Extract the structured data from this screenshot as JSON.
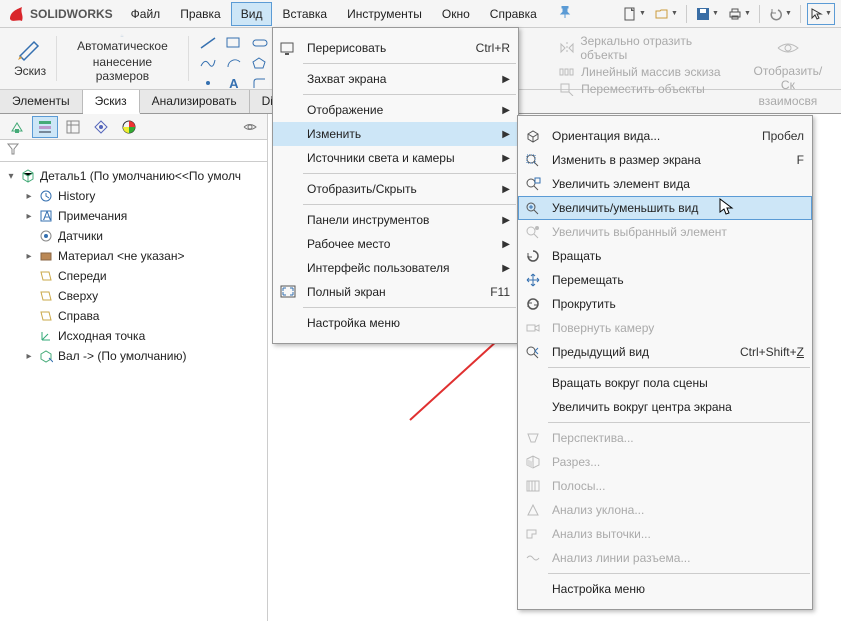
{
  "app": {
    "name": "SOLIDWORKS"
  },
  "menubar": {
    "items": [
      "Файл",
      "Правка",
      "Вид",
      "Вставка",
      "Инструменты",
      "Окно",
      "Справка"
    ],
    "active_index": 2
  },
  "ribbon": {
    "sketch_label": "Эскиз",
    "smartdim_label_1": "Автоматическое",
    "smartdim_label_2": "нанесение размеров",
    "disabled_cmds": {
      "mirror": "Зеркально отразить объекты",
      "linear": "Линейный массив эскиза",
      "move": "Переместить объекты"
    },
    "display_label_1": "Отобразить/Ск",
    "display_label_2": "взаимосвя"
  },
  "tabs": [
    "Элементы",
    "Эскиз",
    "Анализировать",
    "DimXp"
  ],
  "active_tab_index": 1,
  "tree": {
    "root": "Деталь1  (По умолчанию<<По умолч",
    "items": [
      {
        "expander": "▸",
        "label": "History"
      },
      {
        "expander": "▸",
        "label": "Примечания"
      },
      {
        "expander": "",
        "label": "Датчики"
      },
      {
        "expander": "▸",
        "label": "Материал <не указан>"
      },
      {
        "expander": "",
        "label": "Спереди"
      },
      {
        "expander": "",
        "label": "Сверху"
      },
      {
        "expander": "",
        "label": "Справа"
      },
      {
        "expander": "",
        "label": "Исходная точка"
      },
      {
        "expander": "▸",
        "label": "Вал -> (По умолчанию)"
      }
    ]
  },
  "view_menu": {
    "items": [
      {
        "icon": "redraw",
        "label": "Перерисовать",
        "shortcut": "Ctrl+R",
        "arrow": false,
        "sep_after": true
      },
      {
        "icon": "",
        "label": "Захват экрана",
        "shortcut": "",
        "arrow": true,
        "sep_after": true
      },
      {
        "icon": "",
        "label": "Отображение",
        "shortcut": "",
        "arrow": true,
        "sep_after": false
      },
      {
        "icon": "",
        "label": "Изменить",
        "shortcut": "",
        "arrow": true,
        "sep_after": false,
        "highlight": true
      },
      {
        "icon": "",
        "label": "Источники света и камеры",
        "shortcut": "",
        "arrow": true,
        "sep_after": true
      },
      {
        "icon": "",
        "label": "Отобразить/Скрыть",
        "shortcut": "",
        "arrow": true,
        "sep_after": true
      },
      {
        "icon": "",
        "label": "Панели инструментов",
        "shortcut": "",
        "arrow": true,
        "sep_after": false
      },
      {
        "icon": "",
        "label": "Рабочее место",
        "shortcut": "",
        "arrow": true,
        "sep_after": false
      },
      {
        "icon": "",
        "label": "Интерфейс пользователя",
        "shortcut": "",
        "arrow": true,
        "sep_after": false
      },
      {
        "icon": "fullscreen",
        "label": "Полный экран",
        "shortcut": "F11",
        "arrow": false,
        "sep_after": true
      },
      {
        "icon": "",
        "label": "Настройка меню",
        "shortcut": "",
        "arrow": false,
        "sep_after": false
      }
    ]
  },
  "modify_submenu": {
    "items": [
      {
        "icon": "orient",
        "label": "Ориентация вида...",
        "shortcut": "Пробел",
        "disabled": false
      },
      {
        "icon": "zoomfit",
        "label": "Изменить в размер экрана",
        "shortcut": "F",
        "disabled": false
      },
      {
        "icon": "zoomsel",
        "label": "Увеличить элемент вида",
        "shortcut": "",
        "disabled": false
      },
      {
        "icon": "zoom",
        "label": "Увеличить/уменьшить вид",
        "shortcut": "",
        "disabled": false,
        "hovered": true
      },
      {
        "icon": "zoomsel2",
        "label": "Увеличить выбранный элемент",
        "shortcut": "",
        "disabled": true
      },
      {
        "icon": "rotate",
        "label": "Вращать",
        "shortcut": "",
        "disabled": false
      },
      {
        "icon": "pan",
        "label": "Перемещать",
        "shortcut": "",
        "disabled": false
      },
      {
        "icon": "roll",
        "label": "Прокрутить",
        "shortcut": "",
        "disabled": false
      },
      {
        "icon": "cam",
        "label": "Повернуть камеру",
        "shortcut": "",
        "disabled": true
      },
      {
        "icon": "prev",
        "label": "Предыдущий вид",
        "shortcut": "Ctrl+Shift+Z",
        "disabled": false,
        "sep_after": true
      },
      {
        "icon": "",
        "label": "Вращать вокруг пола сцены",
        "shortcut": "",
        "disabled": false
      },
      {
        "icon": "",
        "label": "Увеличить вокруг центра экрана",
        "shortcut": "",
        "disabled": false,
        "sep_after": true
      },
      {
        "icon": "persp",
        "label": "Перспектива...",
        "shortcut": "",
        "disabled": true
      },
      {
        "icon": "section",
        "label": "Разрез...",
        "shortcut": "",
        "disabled": true
      },
      {
        "icon": "stripes",
        "label": "Полосы...",
        "shortcut": "",
        "disabled": true
      },
      {
        "icon": "draft",
        "label": "Анализ уклона...",
        "shortcut": "",
        "disabled": true
      },
      {
        "icon": "undercut",
        "label": "Анализ выточки...",
        "shortcut": "",
        "disabled": true
      },
      {
        "icon": "parting",
        "label": "Анализ линии разъема...",
        "shortcut": "",
        "disabled": true,
        "sep_after": true
      },
      {
        "icon": "",
        "label": "Настройка меню",
        "shortcut": "",
        "disabled": false
      }
    ]
  }
}
